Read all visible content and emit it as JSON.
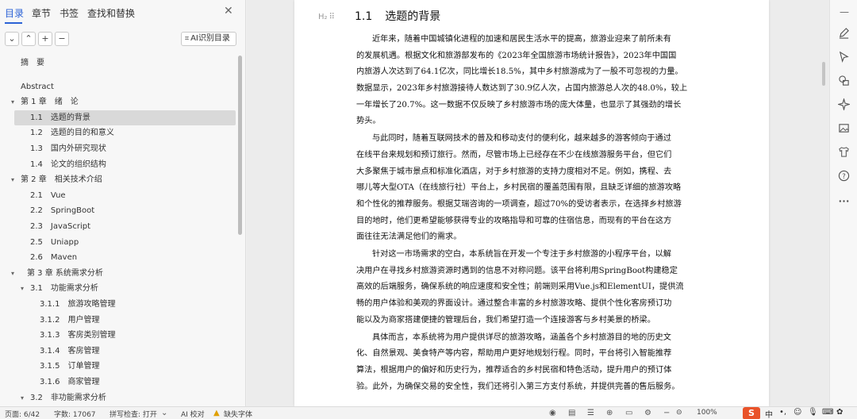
{
  "nav": {
    "tabs": [
      "目录",
      "章节",
      "书签",
      "查找和替换"
    ],
    "active_tab": "目录",
    "tools": {
      "collapse": "⌄",
      "expand": "⌃",
      "add": "+",
      "remove": "−",
      "ai_toc_label": "AI识别目录"
    },
    "toc": [
      {
        "label": "摘　要",
        "level": 0,
        "arrow": ""
      },
      {
        "label": "Abstract",
        "level": 0,
        "arrow": ""
      },
      {
        "label": "第 1 章　绪　论",
        "level": 0,
        "arrow": "▾"
      },
      {
        "label": "1.1　选题的背景",
        "level": 1,
        "arrow": "",
        "selected": true
      },
      {
        "label": "1.2　选题的目的和意义",
        "level": 1,
        "arrow": ""
      },
      {
        "label": "1.3　国内外研究现状",
        "level": 1,
        "arrow": ""
      },
      {
        "label": "1.4　论文的组织结构",
        "level": 1,
        "arrow": ""
      },
      {
        "label": "第 2 章　相关技术介绍",
        "level": 0,
        "arrow": "▾"
      },
      {
        "label": "2.1　Vue",
        "level": 1,
        "arrow": ""
      },
      {
        "label": "2.2　SpringBoot",
        "level": 1,
        "arrow": ""
      },
      {
        "label": "2.3　JavaScript",
        "level": 1,
        "arrow": ""
      },
      {
        "label": "2.5　Uniapp",
        "level": 1,
        "arrow": ""
      },
      {
        "label": "2.6　Maven",
        "level": 1,
        "arrow": ""
      },
      {
        "label": "第 3 章 系统需求分析",
        "level": 0,
        "arrow": "▾"
      },
      {
        "label": "3.1　功能需求分析",
        "level": 1,
        "arrow": "▾"
      },
      {
        "label": "3.1.1　旅游攻略管理",
        "level": 2,
        "arrow": ""
      },
      {
        "label": "3.1.2　用户管理",
        "level": 2,
        "arrow": ""
      },
      {
        "label": "3.1.3　客房类别管理",
        "level": 2,
        "arrow": ""
      },
      {
        "label": "3.1.4　客房管理",
        "level": 2,
        "arrow": ""
      },
      {
        "label": "3.1.5　订单管理",
        "level": 2,
        "arrow": ""
      },
      {
        "label": "3.1.6　商家管理",
        "level": 2,
        "arrow": ""
      },
      {
        "label": "3.2　非功能需求分析",
        "level": 1,
        "arrow": "▾"
      }
    ]
  },
  "document": {
    "heading_marker": "H₂",
    "heading_number": "1.1",
    "heading_title": "选题的背景",
    "paragraphs": [
      {
        "lines": [
          "近年来，随着中国城镇化进程的加速和居民生活水平的提高，旅游业迎来了前所未有",
          "的发展机遇。根据文化和旅游部发布的《2023年全国旅游市场统计报告》，2023年中国国",
          "内旅游人次达到了64.1亿次，同比增长18.5%，其中乡村旅游成为了一股不可忽视的力量。",
          "数据显示，2023年乡村旅游接待人数达到了30.9亿人次，占国内旅游总人次的48.0%，较上",
          "一年增长了20.7%。这一数据不仅反映了乡村旅游市场的庞大体量，也显示了其强劲的增长",
          "势头。"
        ]
      },
      {
        "lines": [
          "与此同时，随着互联网技术的普及和移动支付的便利化，越来越多的游客倾向于通过",
          "在线平台来规划和预订旅行。然而，尽管市场上已经存在不少在线旅游服务平台，但它们",
          "大多聚焦于城市景点和标准化酒店，对于乡村旅游的支持力度相对不足。例如，携程、去",
          "哪儿等大型OTA（在线旅行社）平台上，乡村民宿的覆盖范围有限，且缺乏详细的旅游攻略",
          "和个性化的推荐服务。根据艾瑞咨询的一项调查，超过70%的受访者表示，在选择乡村旅游",
          "目的地时，他们更希望能够获得专业的攻略指导和可靠的住宿信息，而现有的平台在这方",
          "面往往无法满足他们的需求。"
        ]
      },
      {
        "lines": [
          "针对这一市场需求的空白，本系统旨在开发一个专注于乡村旅游的小程序平台，以解",
          "决用户在寻找乡村旅游资源时遇到的信息不对称问题。该平台将利用SpringBoot构建稳定",
          "高效的后端服务，确保系统的响应速度和安全性；前端则采用Vue.js和ElementUI，提供流",
          "畅的用户体验和美观的界面设计。通过整合丰富的乡村旅游攻略、提供个性化客房预订功",
          "能以及为商家搭建便捷的管理后台，我们希望打造一个连接游客与乡村美景的桥梁。"
        ]
      },
      {
        "lines": [
          "具体而言，本系统将为用户提供详尽的旅游攻略，涵盖各个乡村旅游目的地的历史文",
          "化、自然景观、美食特产等内容，帮助用户更好地规划行程。同时，平台将引入智能推荐",
          "算法，根据用户的偏好和历史行为，推荐适合的乡村民宿和特色活动，提升用户的预订体",
          "验。此外，为确保交易的安全性，我们还将引入第三方支付系统，并提供完善的售后服务。"
        ]
      }
    ]
  },
  "status": {
    "page": "页面: 6/42",
    "words": "字数: 17067",
    "spellcheck": "拼写检查: 打开",
    "ai_proof": "AI 校对",
    "missing_font": "缺失字体",
    "zoom": "100%",
    "ime_lang": "中",
    "ime_punct": "•,",
    "ime_mood": "☺"
  },
  "colors": {
    "accent": "#2b62d6",
    "warning": "#e0a000",
    "ime_brand": "#e9532a"
  }
}
